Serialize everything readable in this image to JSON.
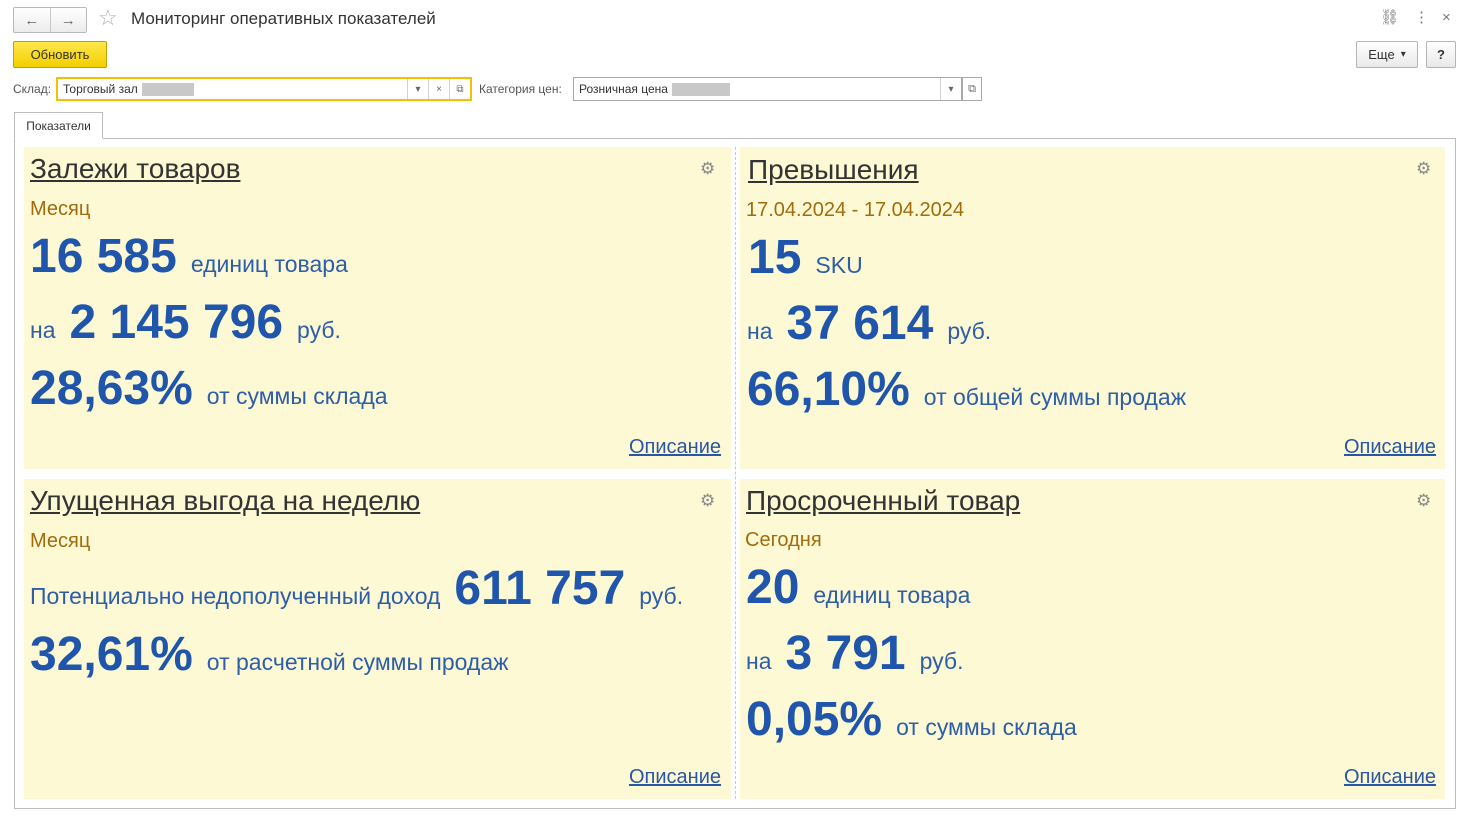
{
  "window": {
    "title": "Мониторинг оперативных показателей",
    "back_icon": "←",
    "forward_icon": "→",
    "star_icon": "☆",
    "link_icon": "⛓",
    "menu_icon": "⋮",
    "close_icon": "×"
  },
  "toolbar": {
    "refresh_label": "Обновить",
    "more_label": "Еще",
    "more_arrow": "▾",
    "help_label": "?"
  },
  "filters": {
    "warehouse_label": "Склад:",
    "warehouse_value": "Торговый зал",
    "price_category_label": "Категория цен:",
    "price_category_value": "Розничная цена",
    "dropdown_icon": "▾",
    "clear_icon": "×",
    "open_icon": "⧉"
  },
  "tabs": {
    "indicators": "Показатели"
  },
  "cards": {
    "stale": {
      "title": "Залежи товаров",
      "period": "Месяц",
      "qty_value": "16 585",
      "qty_unit": "единиц товара",
      "sum_prefix": "на",
      "sum_value": "2 145 796",
      "sum_unit": "руб.",
      "pct_value": "28,63%",
      "pct_text": "от суммы склада",
      "link": "Описание"
    },
    "excess": {
      "title": "Превышения",
      "period": "17.04.2024 - 17.04.2024",
      "qty_value": "15",
      "qty_unit": "SKU",
      "sum_prefix": "на",
      "sum_value": "37 614",
      "sum_unit": "руб.",
      "pct_value": "66,10%",
      "pct_text": "от общей суммы продаж",
      "link": "Описание"
    },
    "lost": {
      "title": "Упущенная выгода на неделю",
      "period": "Месяц",
      "income_prefix": "Потенциально недополученный доход",
      "income_value": "611 757",
      "income_unit": "руб.",
      "pct_value": "32,61%",
      "pct_text": "от расчетной суммы продаж",
      "link": "Описание"
    },
    "expired": {
      "title": "Просроченный товар",
      "period": "Сегодня",
      "qty_value": "20",
      "qty_unit": "единиц товара",
      "sum_prefix": "на",
      "sum_value": "3 791",
      "sum_unit": "руб.",
      "pct_value": "0,05%",
      "pct_text": "от суммы склада",
      "link": "Описание"
    },
    "gear_icon": "⚙"
  }
}
